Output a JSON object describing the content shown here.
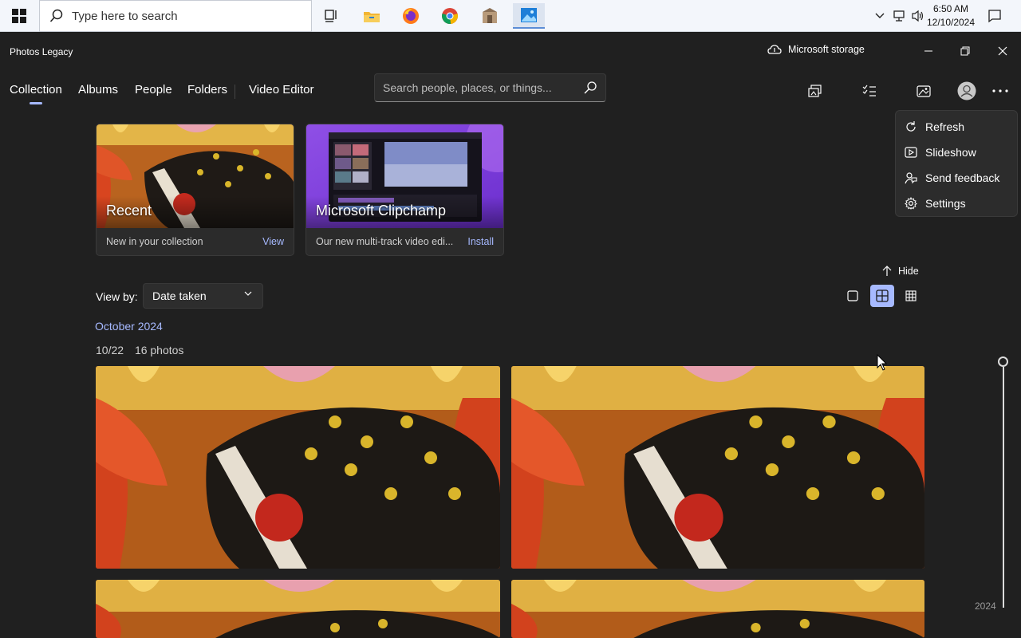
{
  "taskbar": {
    "search_placeholder": "Type here to search",
    "icons": [
      "start-icon",
      "task-view-icon",
      "file-explorer-icon",
      "firefox-icon",
      "chrome-icon",
      "app-icon",
      "photos-icon"
    ],
    "clock": {
      "time": "6:50 AM",
      "date": "12/10/2024"
    }
  },
  "app": {
    "title": "Photos Legacy",
    "storage_label": "Microsoft storage"
  },
  "nav": {
    "items": [
      "Collection",
      "Albums",
      "People",
      "Folders"
    ],
    "video_editor": "Video Editor",
    "active": "Collection",
    "search_placeholder": "Search people, places, or things..."
  },
  "menu": {
    "items": [
      "Refresh",
      "Slideshow",
      "Send feedback",
      "Settings"
    ]
  },
  "cards": [
    {
      "caption": "Recent",
      "sub": "New in your collection",
      "action": "View"
    },
    {
      "caption": "Microsoft Clipchamp",
      "sub": "Our new multi-track video edi...",
      "action": "Install"
    }
  ],
  "view": {
    "hide_label": "Hide",
    "viewby_label": "View by:",
    "viewby_value": "Date taken",
    "selected_mode": "medium-tiles"
  },
  "collection": {
    "month": "October 2024",
    "date": "10/22",
    "count": "16 photos"
  },
  "timeline": {
    "year": "2024"
  },
  "colors": {
    "accent": "#a6b9ff",
    "background": "#202020",
    "menu_bg": "#2c2c2c"
  }
}
